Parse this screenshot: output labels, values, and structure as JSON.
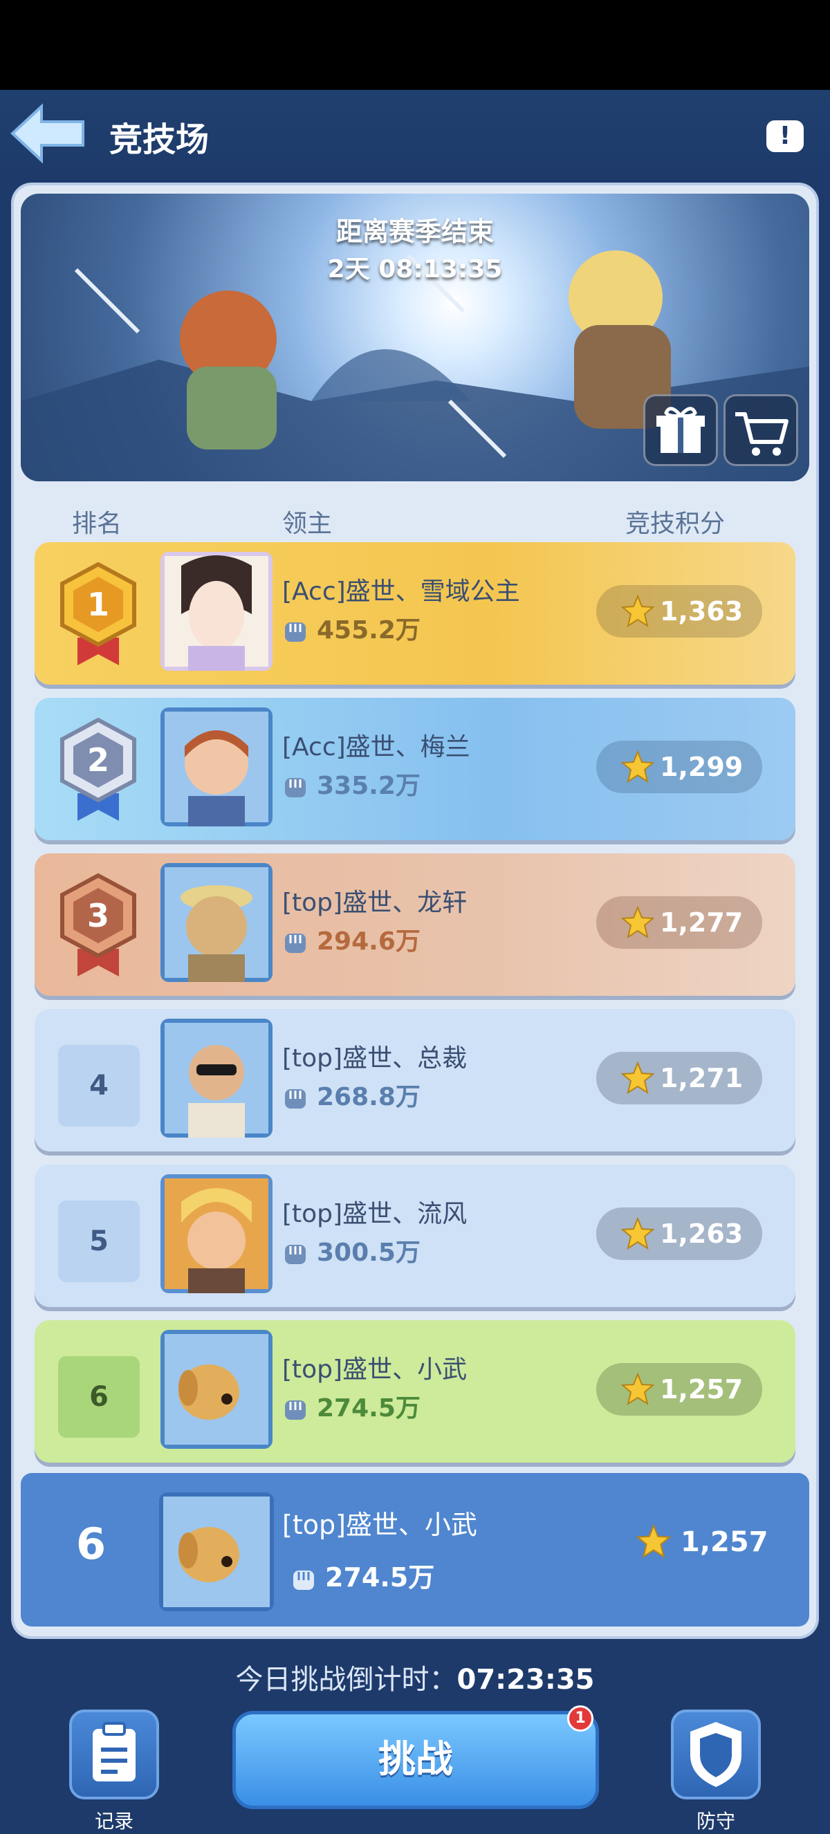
{
  "header": {
    "title": "竞技场",
    "info_label": "!"
  },
  "banner": {
    "season_label": "距离赛季结束",
    "season_time": "2天 08:13:35"
  },
  "columns": {
    "rank": "排名",
    "lord": "领主",
    "score": "竞技积分"
  },
  "colors": {
    "rank1": "#f2c445",
    "rank2": "#8cc4f2",
    "rank3": "#e7b89e",
    "normal": "#cfe1f6",
    "highlight": "#cdeb9a",
    "self": "#4f86cf"
  },
  "rows": [
    {
      "rank": "1",
      "name": "[Acc]盛世、雪域公主",
      "power": "455.2万",
      "score": "1,363"
    },
    {
      "rank": "2",
      "name": "[Acc]盛世、梅兰",
      "power": "335.2万",
      "score": "1,299"
    },
    {
      "rank": "3",
      "name": "[top]盛世、龙轩",
      "power": "294.6万",
      "score": "1,277"
    },
    {
      "rank": "4",
      "name": "[top]盛世、总裁",
      "power": "268.8万",
      "score": "1,271"
    },
    {
      "rank": "5",
      "name": "[top]盛世、流风",
      "power": "300.5万",
      "score": "1,263"
    },
    {
      "rank": "6",
      "name": "[top]盛世、小武",
      "power": "274.5万",
      "score": "1,257"
    }
  ],
  "self": {
    "rank": "6",
    "name": "[top]盛世、小武",
    "power": "274.5万",
    "score": "1,257"
  },
  "countdown": {
    "label": "今日挑战倒计时：",
    "time": "07:23:35"
  },
  "bottom": {
    "records_label": "记录",
    "challenge_label": "挑战",
    "challenge_badge": "1",
    "defense_label": "防守"
  }
}
